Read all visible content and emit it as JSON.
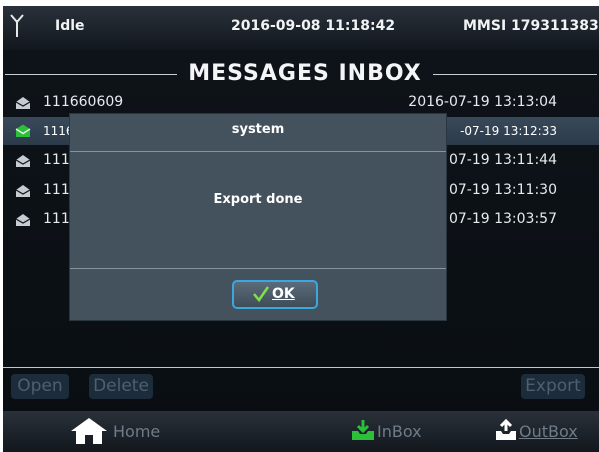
{
  "status": {
    "state": "Idle",
    "datetime": "2016-09-08 11:18:42",
    "mmsi": "MMSI 179311383"
  },
  "title": "MESSAGES  INBOX",
  "messages": [
    {
      "from": "111660609",
      "date": "2016-07-19  13:13:04",
      "icon": "envelope-read-icon"
    },
    {
      "from": "1116",
      "date": "-07-19  13:12:33",
      "icon": "envelope-unread-icon",
      "selected": true
    },
    {
      "from": "111",
      "date": "07-19  13:11:44",
      "icon": "envelope-read-icon"
    },
    {
      "from": "111",
      "date": "07-19  13:11:30",
      "icon": "envelope-read-icon"
    },
    {
      "from": "111",
      "date": "07-19  13:03:57",
      "icon": "envelope-read-icon"
    }
  ],
  "actions": {
    "open": "Open",
    "delete": "Delete",
    "export": "Export"
  },
  "nav": {
    "home": "Home",
    "inbox": "InBox",
    "outbox": "OutBox"
  },
  "dialog": {
    "title": "system",
    "message": "Export done",
    "ok_label": "OK"
  },
  "colors": {
    "accent": "#3aa7e0",
    "inbox_green": "#2bbf3a",
    "selected_row": "#33475a",
    "disabled_text": "#4d5f70"
  }
}
